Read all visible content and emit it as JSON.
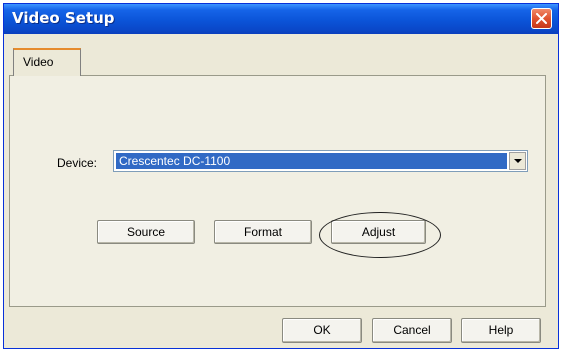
{
  "window": {
    "title": "Video Setup",
    "close_icon": "close-icon"
  },
  "tabs": [
    {
      "label": "Video",
      "active": true
    }
  ],
  "device": {
    "label": "Device:",
    "selected_value": "Crescentec DC-1100"
  },
  "actions": {
    "source_label": "Source",
    "format_label": "Format",
    "adjust_label": "Adjust"
  },
  "footer": {
    "ok_label": "OK",
    "cancel_label": "Cancel",
    "help_label": "Help"
  },
  "colors": {
    "title_bar": "#0b54d8",
    "dialog_background": "#ece9d8",
    "selection_highlight": "#316ac5",
    "close_button": "#e0532f"
  }
}
